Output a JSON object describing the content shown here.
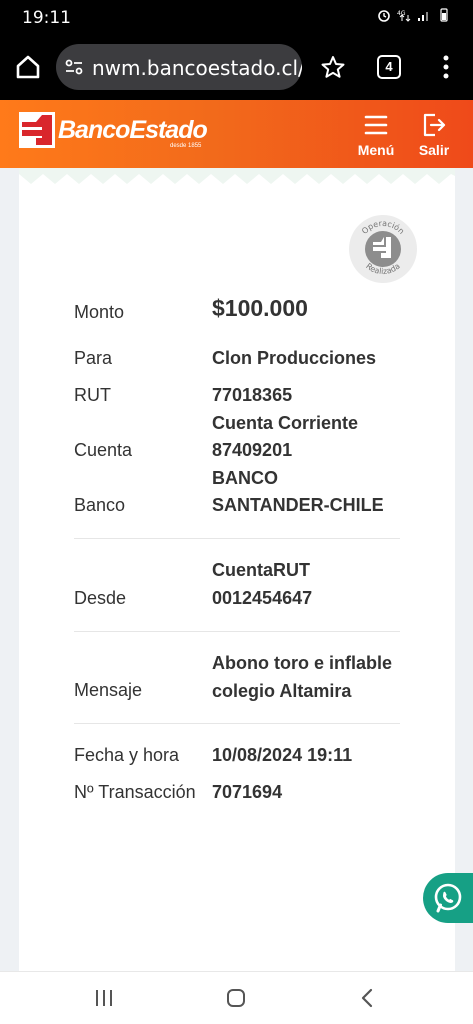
{
  "status_bar": {
    "time": "19:11"
  },
  "browser": {
    "url": "nwm.bancoestado.cl/c",
    "tab_count": "4"
  },
  "header": {
    "brand": "BancoEstado",
    "brand_sub": "desde 1855",
    "menu_label": "Menú",
    "exit_label": "Salir"
  },
  "stamp": {
    "top_text": "Operación",
    "bottom_text": "Realizada"
  },
  "details": {
    "monto_label": "Monto",
    "monto_value": "$100.000",
    "para_label": "Para",
    "para_value": "Clon Producciones",
    "rut_label": "RUT",
    "rut_value": "77018365",
    "cuenta_label": "Cuenta",
    "cuenta_value_1": "Cuenta Corriente",
    "cuenta_value_2": "87409201",
    "banco_label": "Banco",
    "banco_value_1": "BANCO",
    "banco_value_2": "SANTANDER-CHILE",
    "desde_label": "Desde",
    "desde_value_1": "CuentaRUT",
    "desde_value_2": "0012454647",
    "mensaje_label": "Mensaje",
    "mensaje_value_1": "Abono toro e inflable",
    "mensaje_value_2": "colegio Altamira",
    "fecha_label": "Fecha y hora",
    "fecha_value": "10/08/2024 19:11",
    "transaccion_label": "Nº Transacción",
    "transaccion_value": "7071694"
  },
  "colors": {
    "brand_orange": "#f26a1b",
    "brand_red": "#d9262c",
    "whatsapp": "#16a085"
  }
}
